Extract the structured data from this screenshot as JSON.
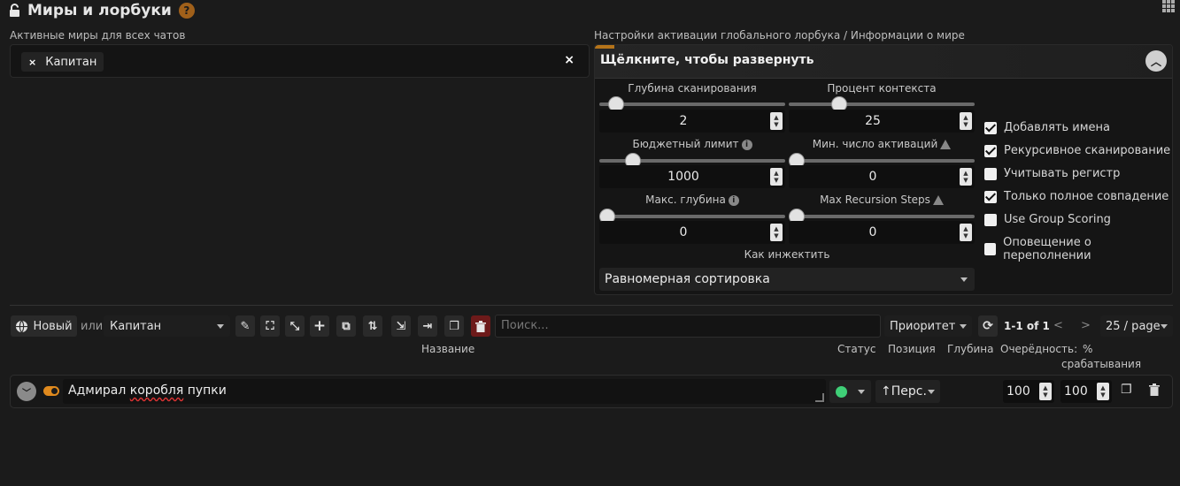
{
  "header": {
    "title": "Миры и лорбуки",
    "help": "?"
  },
  "active_worlds": {
    "label": "Активные миры для всех чатов",
    "chips": [
      "Капитан"
    ],
    "chip_remove": "×",
    "clear": "×"
  },
  "settings": {
    "label": "Настройки активации глобального лорбука / Информации о мире",
    "toggle_title": "Щёлкните, чтобы развернуть",
    "scan_depth": {
      "label": "Глубина сканирования",
      "value": "2",
      "level": 0.05
    },
    "context_percent": {
      "label": "Процент контекста",
      "value": "25",
      "level": 0.25
    },
    "budget_cap": {
      "label": "Бюджетный лимит",
      "value": "1000",
      "level": 0.15
    },
    "min_activations": {
      "label": "Мин. число активаций",
      "value": "0",
      "level": 0
    },
    "max_depth": {
      "label": "Макс. глубина",
      "value": "0",
      "level": 0
    },
    "max_recursion": {
      "label": "Max Recursion Steps",
      "value": "0",
      "level": 0
    },
    "insertion": {
      "label": "Как инжектить",
      "value": "Равномерная сортировка"
    },
    "checkboxes": [
      {
        "label": "Добавлять имена",
        "checked": true
      },
      {
        "label": "Рекурсивное сканирование",
        "checked": true
      },
      {
        "label": "Учитывать регистр",
        "checked": false
      },
      {
        "label": "Только полное совпадение",
        "checked": true
      },
      {
        "label": "Use Group Scoring",
        "checked": false
      },
      {
        "label": "Оповещение о переполнении",
        "checked": false
      }
    ]
  },
  "toolbar": {
    "new_label": "Новый",
    "or_label": "или",
    "world_select": "Капитан",
    "search_placeholder": "Поиск...",
    "sort_select": "Приоритет",
    "pagination": "1-1 of 1",
    "prev": "<",
    "next": ">",
    "page_size": "25 / page"
  },
  "columns": {
    "title": "Название",
    "status": "Статус",
    "position": "Позиция",
    "depth": "Глубина",
    "order": "Очерёдность:",
    "trigger": "%",
    "trigger2": "срабатывания"
  },
  "entries": [
    {
      "name_part1": "Адмирал ",
      "name_misspelled": "коробля",
      "name_part2": " пупки",
      "position": "↑Перс.",
      "order": "100",
      "trigger": "100"
    }
  ]
}
